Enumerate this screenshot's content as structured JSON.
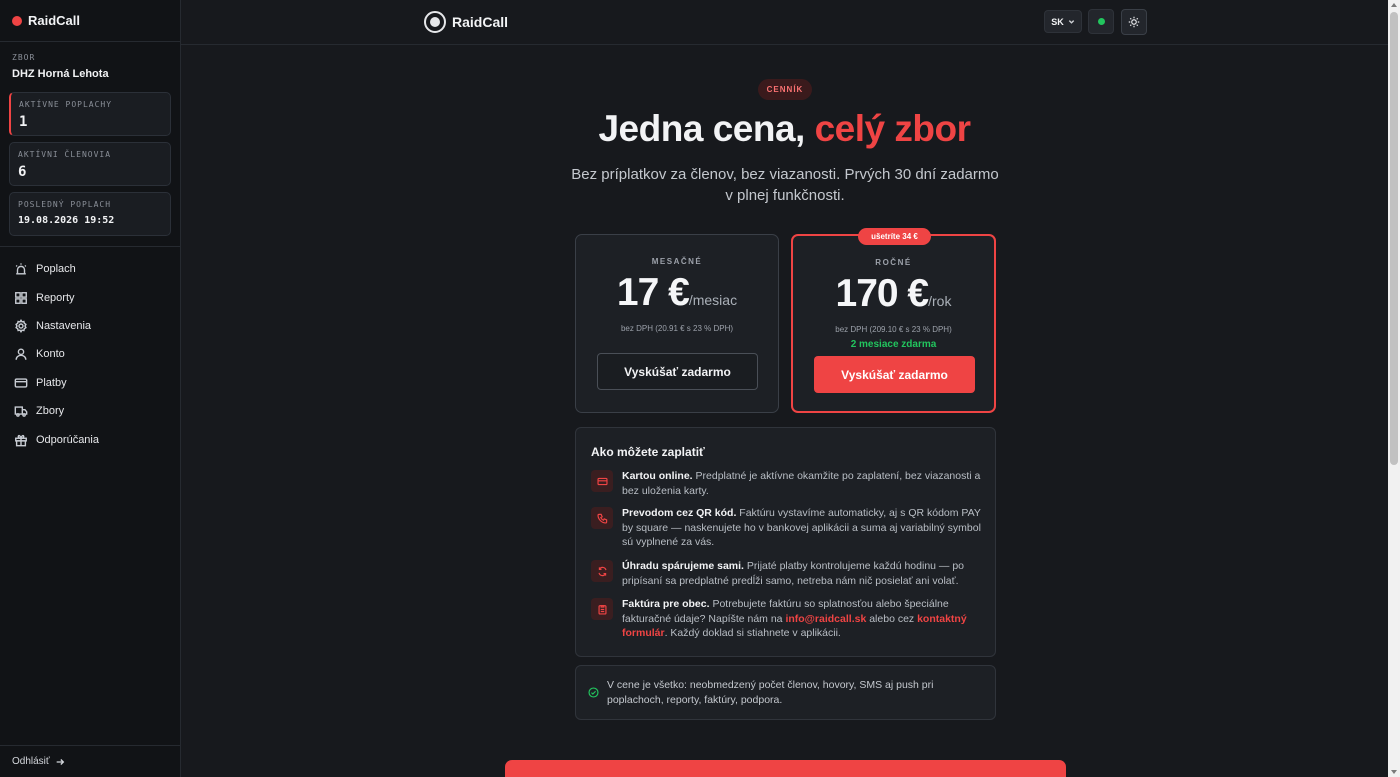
{
  "sidebar": {
    "brand": "RaidCall",
    "org_label": "ZBOR",
    "org_name": "DHZ Horná Lehota",
    "stats": [
      {
        "label": "AKTÍVNE POPLACHY",
        "value": "1"
      },
      {
        "label": "AKTÍVNI ČLENOVIA",
        "value": "6"
      },
      {
        "label": "POSLEDNÝ POPLACH",
        "value": "19.08.2026 19:52"
      }
    ],
    "nav": [
      {
        "label": "Poplach",
        "icon": "siren-icon"
      },
      {
        "label": "Reporty",
        "icon": "grid-icon"
      },
      {
        "label": "Nastavenia",
        "icon": "gear-icon"
      },
      {
        "label": "Konto",
        "icon": "user-icon"
      },
      {
        "label": "Platby",
        "icon": "credit-card-icon"
      },
      {
        "label": "Zbory",
        "icon": "truck-icon"
      },
      {
        "label": "Odporúčania",
        "icon": "gift-icon"
      }
    ],
    "logout": "Odhlásiť"
  },
  "topbar": {
    "logo_text": "RaidCall",
    "language": "SK"
  },
  "main": {
    "badge": "CENNÍK",
    "title_main": "Jedna cena, ",
    "title_accent": "celý zbor",
    "subtitle": "Bez príplatkov za členov, bez viazanosti. Prvých 30 dní zadarmo v plnej funkčnosti.",
    "plans": {
      "monthly": {
        "label": "MESAČNÉ",
        "price": "17 €",
        "unit": "/mesiac",
        "vat": "bez DPH (20.91 € s 23 % DPH)",
        "button": "Vyskúšať zadarmo"
      },
      "yearly": {
        "save_badge": "ušetríte 34 €",
        "label": "ROČNÉ",
        "price": "170 €",
        "unit": "/rok",
        "vat": "bez DPH (209.10 € s 23 % DPH)",
        "bonus": "2 mesiace zdarma",
        "button": "Vyskúšať zadarmo"
      }
    },
    "payment": {
      "title": "Ako môžete zaplatiť",
      "items": [
        {
          "title": "Kartou online.",
          "text": " Predplatné je aktívne okamžite po zaplatení, bez viazanosti a bez uloženia karty."
        },
        {
          "title": "Prevodom cez QR kód.",
          "text": " Faktúru vystavíme automaticky, aj s QR kódom PAY by square — naskenujete ho v bankovej aplikácii a suma aj variabilný symbol sú vyplnené za vás."
        },
        {
          "title": "Úhradu spárujeme sami.",
          "text": " Prijaté platby kontrolujeme každú hodinu — po pripísaní sa predplatné predĺži samo, netreba nám nič posielať ani volať."
        },
        {
          "title": "Faktúra pre obec.",
          "text": " Potrebujete faktúru so splatnosťou alebo špeciálne fakturačné údaje? Napíšte nám na ",
          "email": "info@raidcall.sk",
          "middle": " alebo cez ",
          "link": "kontaktný formulár",
          "tail": ". Každý doklad si stiahnete v aplikácii."
        }
      ]
    },
    "included": "V cene je všetko: neobmedzený počet členov, hovory, SMS aj push pri poplachoch, reporty, faktúry, podpora."
  },
  "colors": {
    "accent": "#ef4444",
    "success": "#22c55e",
    "background": "#17191d",
    "sidebar": "#111316"
  }
}
